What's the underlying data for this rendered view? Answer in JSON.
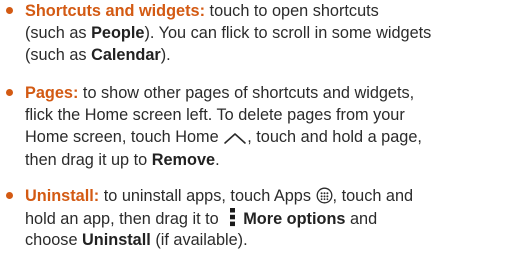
{
  "items": [
    {
      "title": "Shortcuts and widgets:",
      "lines": [
        {
          "a": " touch to open shortcuts"
        },
        {
          "a": "(such as ",
          "b1": "People",
          "c": "). You can flick to scroll in some widgets"
        },
        {
          "a": "(such as ",
          "b1": "Calendar",
          "c": ")."
        }
      ]
    },
    {
      "title": "Pages:",
      "lines": [
        {
          "a": " to show other pages of shortcuts and widgets,"
        },
        {
          "a": "flick the Home screen left. To delete pages from your"
        },
        {
          "a": "Home screen, touch Home ",
          "c": ", touch and hold a page,"
        },
        {
          "a": "then drag it up to ",
          "b1": "Remove",
          "c": "."
        }
      ],
      "home_icon": "home-icon"
    },
    {
      "title": "Uninstall:",
      "lines": [
        {
          "a": " to uninstall apps, touch Apps ",
          "c": ", touch and"
        },
        {
          "a": "hold an app, then drag it to ",
          "b1": "More options",
          "c": " and"
        },
        {
          "a": "choose ",
          "b1": "Uninstall",
          "c": " (if available)."
        }
      ],
      "apps_icon": "apps-icon",
      "more_icon": "more-options-icon"
    }
  ],
  "colors": {
    "accent": "#d35a13",
    "text": "#2b2b2b"
  }
}
